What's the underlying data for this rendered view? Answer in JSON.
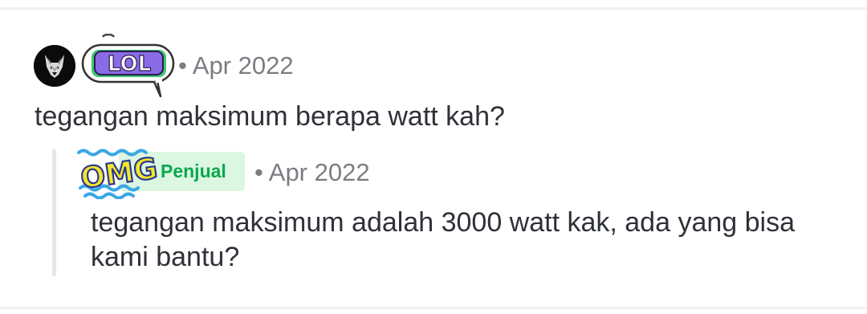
{
  "question": {
    "badge_text": "LOL",
    "meta": {
      "separator": "•",
      "date": "Apr 2022"
    },
    "text": "tegangan maksimum berapa watt kah?"
  },
  "reply": {
    "badge_text": "OMG",
    "seller_label": "Penjual",
    "meta": {
      "separator": "•",
      "date": "Apr 2022"
    },
    "text": "tegangan maksimum adalah 3000 watt kak, ada yang bisa kami bantu?"
  },
  "icons": {
    "question_avatar": "wolf-avatar-icon",
    "question_badge": "lol-speech-bubble-icon",
    "reply_badge": "omg-sticker-icon"
  },
  "colors": {
    "primary_text": "#2e3137",
    "meta_text": "#7a7d82",
    "seller_green": "#09a84c",
    "seller_pill_bg": "#dbf6e1",
    "lol_purple": "#8a6be6",
    "lol_green": "#3fc66d",
    "omg_yellow": "#f4e628",
    "omg_blue": "#3aa7e6"
  }
}
